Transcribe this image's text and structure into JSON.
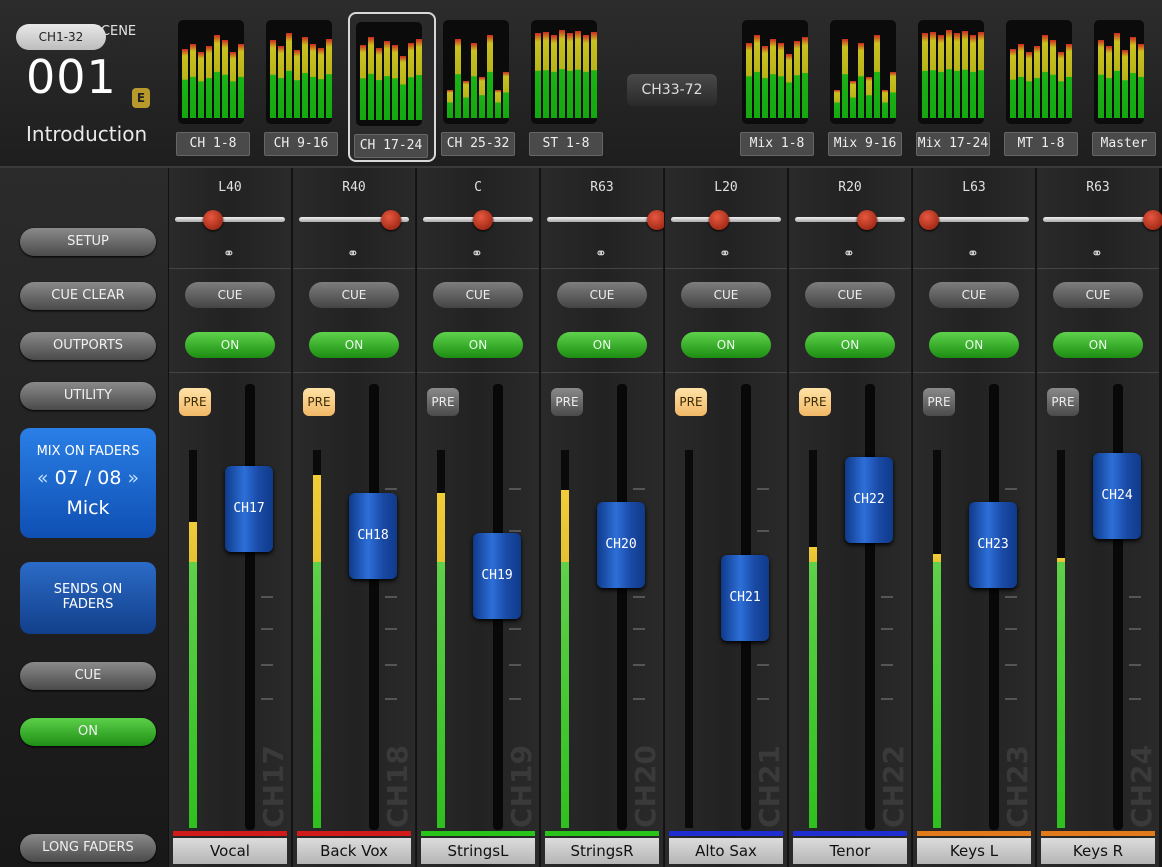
{
  "scene": {
    "label": "CURRENT SCENE",
    "number": "001",
    "edit_badge": "E",
    "name": "Introduction"
  },
  "banks_left": [
    {
      "label": "CH 1-8",
      "selected": false
    },
    {
      "label": "CH 9-16",
      "selected": false
    },
    {
      "label": "CH 17-24",
      "selected": true
    },
    {
      "label": "CH 25-32",
      "selected": false
    },
    {
      "label": "ST 1-8",
      "selected": false
    }
  ],
  "range_buttons": {
    "ch1_32": "CH1-32",
    "ch33_72": "CH33-72"
  },
  "banks_right": [
    {
      "label": "Mix 1-8"
    },
    {
      "label": "Mix 9-16"
    },
    {
      "label": "Mix 17-24"
    },
    {
      "label": "MT 1-8"
    },
    {
      "label": "Master"
    }
  ],
  "sidebar": {
    "setup": "SETUP",
    "cue_clear": "CUE CLEAR",
    "outports": "OUTPORTS",
    "utility": "UTILITY",
    "mix_on_faders": {
      "title": "MIX ON FADERS",
      "index": "07 / 08",
      "name": "Mick",
      "prev": "«",
      "next": "»"
    },
    "sends_on_faders": {
      "line1": "SENDS ON",
      "line2": "FADERS"
    },
    "cue": "CUE",
    "on": "ON",
    "long_faders": "LONG FADERS"
  },
  "channels": [
    {
      "pan": "L40",
      "cue": "CUE",
      "on": "ON",
      "pre": "PRE",
      "pre_active": true,
      "fader_label": "CH17",
      "ghost": "CH17",
      "name": "Vocal",
      "color": "#d11a1a",
      "level": 0.72,
      "meter": 0.85
    },
    {
      "pan": "R40",
      "cue": "CUE",
      "on": "ON",
      "pre": "PRE",
      "pre_active": true,
      "fader_label": "CH18",
      "ghost": "CH18",
      "name": "Back Vox",
      "color": "#d11a1a",
      "level": 0.66,
      "meter": 0.98
    },
    {
      "pan": "C",
      "cue": "CUE",
      "on": "ON",
      "pre": "PRE",
      "pre_active": false,
      "fader_label": "CH19",
      "ghost": "CH19",
      "name": "StringsL",
      "color": "#29c41a",
      "level": 0.57,
      "meter": 0.93
    },
    {
      "pan": "R63",
      "cue": "CUE",
      "on": "ON",
      "pre": "PRE",
      "pre_active": false,
      "fader_label": "CH20",
      "ghost": "CH20",
      "name": "StringsR",
      "color": "#29c41a",
      "level": 0.64,
      "meter": 0.94
    },
    {
      "pan": "L20",
      "cue": "CUE",
      "on": "ON",
      "pre": "PRE",
      "pre_active": true,
      "fader_label": "CH21",
      "ghost": "CH21",
      "name": "Alto Sax",
      "color": "#1f2ed1",
      "level": 0.52,
      "meter": 0.0
    },
    {
      "pan": "R20",
      "cue": "CUE",
      "on": "ON",
      "pre": "PRE",
      "pre_active": true,
      "fader_label": "CH22",
      "ghost": "CH22",
      "name": "Tenor",
      "color": "#1f2ed1",
      "level": 0.74,
      "meter": 0.78
    },
    {
      "pan": "L63",
      "cue": "CUE",
      "on": "ON",
      "pre": "PRE",
      "pre_active": false,
      "fader_label": "CH23",
      "ghost": "CH23",
      "name": "Keys L",
      "color": "#e07a1a",
      "level": 0.64,
      "meter": 0.76
    },
    {
      "pan": "R63",
      "cue": "CUE",
      "on": "ON",
      "pre": "PRE",
      "pre_active": false,
      "fader_label": "CH24",
      "ghost": "CH24",
      "name": "Keys R",
      "color": "#e07a1a",
      "level": 0.75,
      "meter": 0.75
    }
  ],
  "pan_positions": [
    0.28,
    0.82,
    0.5,
    1.0,
    0.38,
    0.62,
    0.0,
    1.0
  ]
}
